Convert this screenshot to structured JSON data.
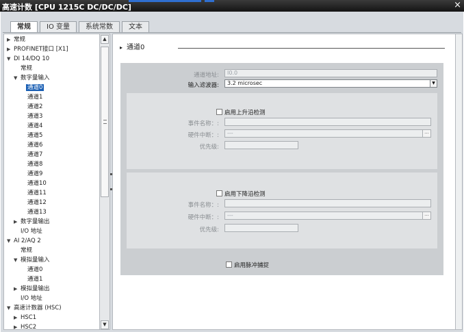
{
  "window": {
    "title": "高速计数 [CPU 1215C DC/DC/DC]",
    "close_label": "×"
  },
  "tabs": [
    {
      "label": "常规",
      "active": true
    },
    {
      "label": "IO 变量",
      "active": false
    },
    {
      "label": "系统常数",
      "active": false
    },
    {
      "label": "文本",
      "active": false
    }
  ],
  "tree": {
    "items": [
      {
        "label": "常规",
        "level": 0,
        "arrow": "▶",
        "selected": false
      },
      {
        "label": "PROFINET接口 [X1]",
        "level": 0,
        "arrow": "▶",
        "selected": false
      },
      {
        "label": "DI 14/DQ 10",
        "level": 0,
        "arrow": "▼",
        "selected": false
      },
      {
        "label": "常规",
        "level": 1,
        "arrow": "",
        "selected": false
      },
      {
        "label": "数字量输入",
        "level": 1,
        "arrow": "▼",
        "selected": false
      },
      {
        "label": "通道0",
        "level": 2,
        "arrow": "",
        "selected": true
      },
      {
        "label": "通道1",
        "level": 2,
        "arrow": "",
        "selected": false
      },
      {
        "label": "通道2",
        "level": 2,
        "arrow": "",
        "selected": false
      },
      {
        "label": "通道3",
        "level": 2,
        "arrow": "",
        "selected": false
      },
      {
        "label": "通道4",
        "level": 2,
        "arrow": "",
        "selected": false
      },
      {
        "label": "通道5",
        "level": 2,
        "arrow": "",
        "selected": false
      },
      {
        "label": "通道6",
        "level": 2,
        "arrow": "",
        "selected": false
      },
      {
        "label": "通道7",
        "level": 2,
        "arrow": "",
        "selected": false
      },
      {
        "label": "通道8",
        "level": 2,
        "arrow": "",
        "selected": false
      },
      {
        "label": "通道9",
        "level": 2,
        "arrow": "",
        "selected": false
      },
      {
        "label": "通道10",
        "level": 2,
        "arrow": "",
        "selected": false
      },
      {
        "label": "通道11",
        "level": 2,
        "arrow": "",
        "selected": false
      },
      {
        "label": "通道12",
        "level": 2,
        "arrow": "",
        "selected": false
      },
      {
        "label": "通道13",
        "level": 2,
        "arrow": "",
        "selected": false
      },
      {
        "label": "数字量输出",
        "level": 1,
        "arrow": "▶",
        "selected": false
      },
      {
        "label": "I/O 地址",
        "level": 1,
        "arrow": "",
        "selected": false
      },
      {
        "label": "AI 2/AQ 2",
        "level": 0,
        "arrow": "▼",
        "selected": false
      },
      {
        "label": "常规",
        "level": 1,
        "arrow": "",
        "selected": false
      },
      {
        "label": "模拟量输入",
        "level": 1,
        "arrow": "▼",
        "selected": false
      },
      {
        "label": "通道0",
        "level": 2,
        "arrow": "",
        "selected": false
      },
      {
        "label": "通道1",
        "level": 2,
        "arrow": "",
        "selected": false
      },
      {
        "label": "模拟量输出",
        "level": 1,
        "arrow": "▶",
        "selected": false
      },
      {
        "label": "I/O 地址",
        "level": 1,
        "arrow": "",
        "selected": false
      },
      {
        "label": "高速计数器 (HSC)",
        "level": 0,
        "arrow": "▼",
        "selected": false
      },
      {
        "label": "HSC1",
        "level": 1,
        "arrow": "▶",
        "selected": false
      },
      {
        "label": "HSC2",
        "level": 1,
        "arrow": "▶",
        "selected": false
      }
    ]
  },
  "channel": {
    "heading": "通道0",
    "address_label": "通道地址:",
    "address_value": "I0.0",
    "filter_label": "输入滤波器:",
    "filter_value": "3.2 microsec",
    "rising": {
      "enable_label": "启用上升沿检测",
      "event_label": "事件名称：:",
      "event_value": "",
      "hw_interrupt_label": "硬件中断：:",
      "hw_interrupt_value": "---",
      "priority_label": "优先级:",
      "priority_value": ""
    },
    "falling": {
      "enable_label": "启用下降沿检测",
      "event_label": "事件名称：:",
      "event_value": "",
      "hw_interrupt_label": "硬件中断：:",
      "hw_interrupt_value": "---",
      "priority_label": "优先级:",
      "priority_value": ""
    },
    "pulse_catch_label": "启用脉冲捕捉"
  },
  "scroll": {
    "up": "▲",
    "down": "▼",
    "dropdown": "▼",
    "ellipsis": "..."
  }
}
